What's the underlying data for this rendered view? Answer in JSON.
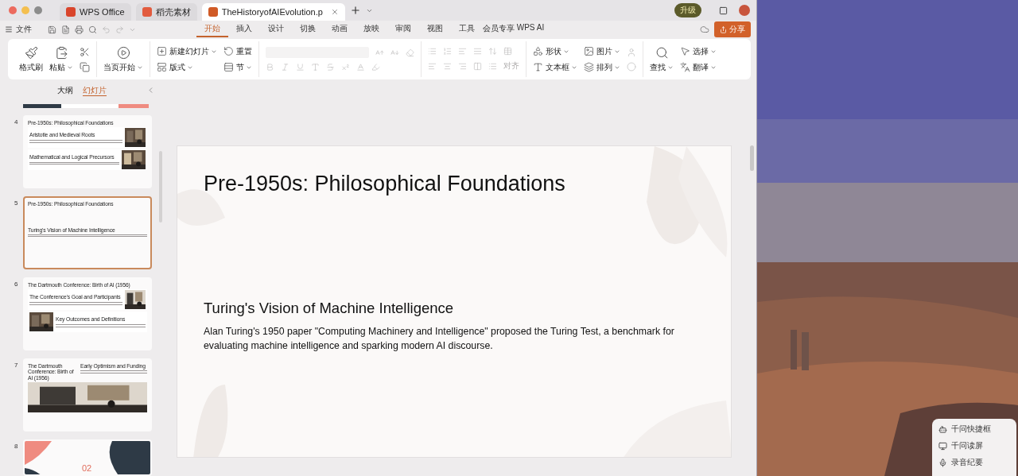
{
  "window": {
    "tabs": [
      {
        "label": "WPS Office",
        "kind": "home",
        "selected": false
      },
      {
        "label": "稻壳素材",
        "kind": "store",
        "selected": false
      },
      {
        "label": "TheHistoryofAIEvolution.p",
        "kind": "doc",
        "selected": true
      }
    ],
    "upgrade": "升级"
  },
  "menu": {
    "file": "文件",
    "tabs": [
      {
        "label": "开始",
        "selected": true
      },
      {
        "label": "插入",
        "selected": false
      },
      {
        "label": "设计",
        "selected": false
      },
      {
        "label": "切换",
        "selected": false
      },
      {
        "label": "动画",
        "selected": false
      },
      {
        "label": "放映",
        "selected": false
      },
      {
        "label": "审阅",
        "selected": false
      },
      {
        "label": "视图",
        "selected": false
      },
      {
        "label": "工具",
        "selected": false
      },
      {
        "label": "会员专享",
        "selected": false
      },
      {
        "label": "WPS AI",
        "selected": false
      }
    ],
    "share": "分享"
  },
  "ribbon": {
    "items": [
      {
        "label": "格式刷",
        "dropdown": false
      },
      {
        "label": "粘贴",
        "dropdown": true
      },
      {
        "label": "当页开始",
        "dropdown": true
      },
      {
        "label": "新建幻灯片",
        "dropdown": true
      },
      {
        "label": "版式",
        "dropdown": true
      },
      {
        "label": "重置",
        "dropdown": false
      },
      {
        "label": "节",
        "dropdown": true
      },
      {
        "label": "形状",
        "dropdown": true
      },
      {
        "label": "文本框",
        "dropdown": true
      },
      {
        "label": "图片",
        "dropdown": true
      },
      {
        "label": "排列",
        "dropdown": true
      },
      {
        "label": "查找",
        "dropdown": true
      },
      {
        "label": "选择",
        "dropdown": true
      },
      {
        "label": "翻译",
        "dropdown": true
      }
    ],
    "font_group": {
      "disabled": true
    },
    "paragraph_group": {
      "disabled": true,
      "align_label": "对齐"
    }
  },
  "sidebar": {
    "tabs": [
      {
        "label": "大纲",
        "selected": false
      },
      {
        "label": "幻灯片",
        "selected": true
      }
    ],
    "slides": [
      {
        "number": "4",
        "kind": "two-sections",
        "selected": false,
        "title": "Pre-1950s: Philosophical Foundations",
        "sections": [
          "Aristotle and Medieval Roots",
          "Mathematical and Logical Precursors"
        ]
      },
      {
        "number": "5",
        "kind": "text",
        "selected": true,
        "title": "Pre-1950s: Philosophical Foundations",
        "sections": [
          "Turing's Vision of Machine Intelligence"
        ]
      },
      {
        "number": "6",
        "kind": "two-sections-alt",
        "selected": false,
        "title": "The Dartmouth Conference: Birth of AI (1956)",
        "sections": [
          "The Conference's Goal and Participants",
          "Key Outcomes and Definitions"
        ]
      },
      {
        "number": "7",
        "kind": "split",
        "selected": false,
        "title": "The Dartmouth Conference: Birth of AI (1956)",
        "sections": [
          "Early Optimism and Funding"
        ]
      },
      {
        "number": "8",
        "kind": "cover",
        "selected": false,
        "title": "02"
      }
    ]
  },
  "slide": {
    "title": "Pre-1950s: Philosophical Foundations",
    "heading": "Turing's Vision of Machine Intelligence",
    "body": "Alan Turing's 1950 paper \"Computing Machinery and Intelligence\" proposed the Turing Test, a benchmark for evaluating machine intelligence and sparking modern AI discourse."
  },
  "desktop": {
    "popup": [
      {
        "label": "千问快捷框",
        "kind": "assistant"
      },
      {
        "label": "千问读屏",
        "kind": "screen"
      },
      {
        "label": "录音纪要",
        "kind": "record"
      }
    ]
  }
}
